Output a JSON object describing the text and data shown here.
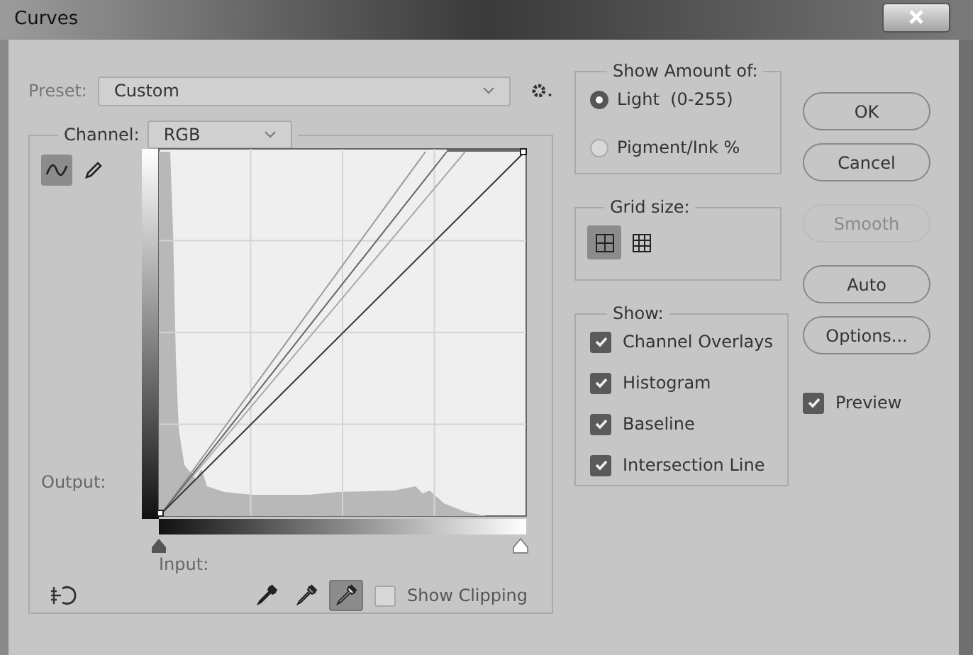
{
  "window": {
    "title": "Curves"
  },
  "preset": {
    "label": "Preset:",
    "value": "Custom"
  },
  "channel": {
    "label": "Channel:",
    "value": "RGB"
  },
  "tools": [
    {
      "kind": "curve",
      "selected": true
    },
    {
      "kind": "pencil",
      "selected": false
    }
  ],
  "output_label": "Output:",
  "input_label": "Input:",
  "eyedroppers": [
    {
      "kind": "black",
      "selected": false
    },
    {
      "kind": "gray",
      "selected": false
    },
    {
      "kind": "white",
      "selected": true
    }
  ],
  "show_clipping": {
    "label": "Show Clipping",
    "checked": false
  },
  "show_amount": {
    "title": "Show Amount of:",
    "options": [
      {
        "label": "Light  (0-255)",
        "selected": true
      },
      {
        "label": "Pigment/Ink %",
        "selected": false
      }
    ]
  },
  "grid_size": {
    "title": "Grid size:",
    "options": [
      {
        "kind": "coarse",
        "selected": true
      },
      {
        "kind": "fine",
        "selected": false
      }
    ]
  },
  "show": {
    "title": "Show:",
    "items": [
      {
        "label": "Channel Overlays",
        "checked": true
      },
      {
        "label": "Histogram",
        "checked": true
      },
      {
        "label": "Baseline",
        "checked": true
      },
      {
        "label": "Intersection Line",
        "checked": true
      }
    ]
  },
  "buttons": [
    {
      "label": "OK",
      "disabled": false
    },
    {
      "label": "Cancel",
      "disabled": false
    },
    {
      "label": "Smooth",
      "disabled": true
    },
    {
      "label": "Auto",
      "disabled": false
    },
    {
      "label": "Options...",
      "disabled": false
    }
  ],
  "preview": {
    "label": "Preview",
    "checked": true
  }
}
